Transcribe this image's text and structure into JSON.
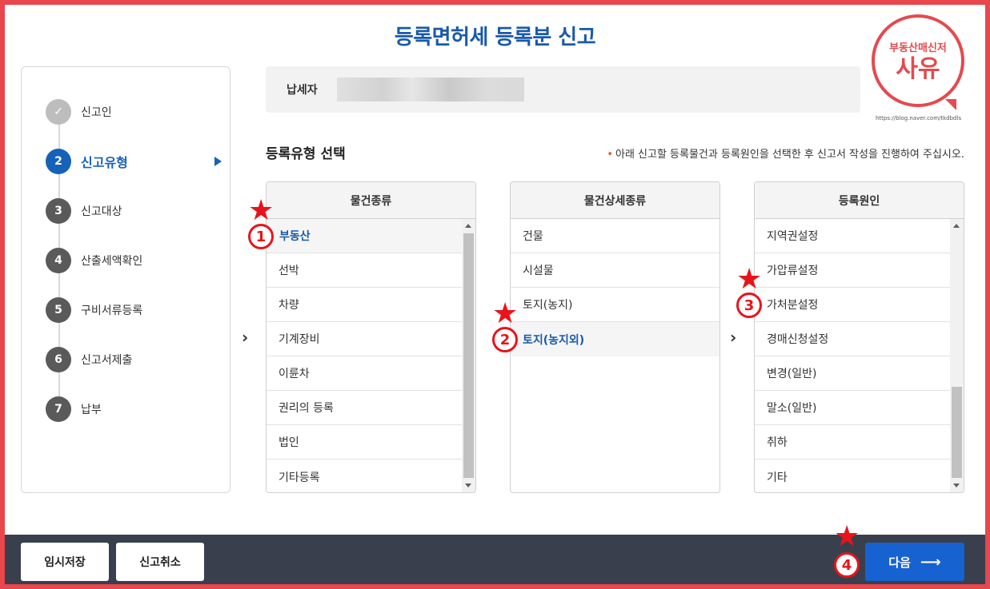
{
  "page": {
    "title": "등록면허세 등록분 신고"
  },
  "steps": [
    {
      "num": "✓",
      "label": "신고인",
      "state": "done"
    },
    {
      "num": "2",
      "label": "신고유형",
      "state": "active"
    },
    {
      "num": "3",
      "label": "신고대상",
      "state": "pending"
    },
    {
      "num": "4",
      "label": "산출세액확인",
      "state": "pending"
    },
    {
      "num": "5",
      "label": "구비서류등록",
      "state": "pending"
    },
    {
      "num": "6",
      "label": "신고서제출",
      "state": "pending"
    },
    {
      "num": "7",
      "label": "납부",
      "state": "pending"
    }
  ],
  "taxpayer": {
    "label": "납세자"
  },
  "logo": {
    "line1": "부동산매신저",
    "line2": "사유",
    "url": "https://blog.naver.com/tkdbdls"
  },
  "section": {
    "title": "등록유형 선택",
    "notice": "아래 신고할 등록물건과 등록원인을 선택한 후 신고서 작성을 진행하여 주십시오."
  },
  "columns": {
    "object_type": {
      "header": "물건종류",
      "items": [
        "부동산",
        "선박",
        "차량",
        "기계장비",
        "이륜차",
        "권리의 등록",
        "법인",
        "기타등록"
      ],
      "selected": "부동산"
    },
    "object_detail": {
      "header": "물건상세종류",
      "items": [
        "건물",
        "시설물",
        "토지(농지)",
        "토지(농지외)"
      ],
      "selected": "토지(농지외)"
    },
    "cause": {
      "header": "등록원인",
      "items": [
        "지역권설정",
        "가압류설정",
        "가처분설정",
        "경매신청설정",
        "변경(일반)",
        "말소(일반)",
        "취하",
        "기타"
      ],
      "selected": "가처분설정"
    }
  },
  "markers": {
    "m1": "1",
    "m2": "2",
    "m3": "3",
    "m4": "4",
    "star": "★"
  },
  "footer": {
    "temp_save": "임시저장",
    "cancel": "신고취소",
    "next": "다음",
    "next_arrow": "⟶"
  },
  "colors": {
    "accent": "#1662b8",
    "frame": "#e8474b",
    "marker": "#e8141b",
    "footer": "#3a3f4d"
  }
}
